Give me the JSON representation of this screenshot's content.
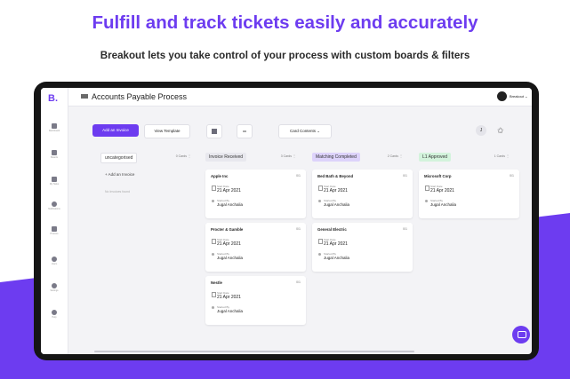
{
  "promo": {
    "title": "Fulfill and track tickets easily and accurately",
    "subtitle": "Breakout lets you take control of your process with custom boards & filters"
  },
  "app": {
    "logo": "B.",
    "title": "Accounts Payable Process",
    "user_name": "Breakout",
    "user_chevron": "⌄"
  },
  "sidebar": {
    "items": [
      {
        "label": "Dashboard",
        "icon": "dashboard-icon"
      },
      {
        "label": "Boards",
        "icon": "folder-icon"
      },
      {
        "label": "My Tasks",
        "icon": "tasks-icon"
      },
      {
        "label": "Notifications",
        "icon": "bell-icon"
      },
      {
        "label": "Process",
        "icon": "layers-icon"
      },
      {
        "label": "Users",
        "icon": "users-icon"
      },
      {
        "label": "Settings",
        "icon": "gear-icon"
      },
      {
        "label": "Help",
        "icon": "help-icon"
      }
    ]
  },
  "toolbar": {
    "add_label": "Add an Invoice",
    "view_label": "View Template",
    "card_contents_label": "Card Contents ⌄",
    "user_initial": "J",
    "star": "✩"
  },
  "columns": [
    {
      "title": "uncategorised",
      "count": "0 Cards",
      "menu": "⋮",
      "add_label": "+ Add an Invoice",
      "empty_label": "No Invoices found",
      "color": "#ffffff",
      "cards": []
    },
    {
      "title": "Invoice Received",
      "count": "3 Cards",
      "menu": "⋮",
      "color": "#e8e8ee",
      "cards": [
        {
          "title": "Apple Inc",
          "num": "0/1",
          "l1": "Start Date",
          "v1": "21 Apr 2021",
          "l2": "Started By",
          "v2": "Jugal Anchalia"
        },
        {
          "title": "Procter & Gamble",
          "num": "0/1",
          "l1": "Start Date",
          "v1": "21 Apr 2021",
          "l2": "Started By",
          "v2": "Jugal Anchalia"
        },
        {
          "title": "Nestle",
          "num": "0/1",
          "l1": "Start Date",
          "v1": "21 Apr 2021",
          "l2": "Started By",
          "v2": "Jugal Anchalia"
        }
      ]
    },
    {
      "title": "Matching Completed",
      "count": "2 Cards",
      "menu": "⋮",
      "color": "#ddd3fb",
      "cards": [
        {
          "title": "Bed Bath & Beyond",
          "num": "0/1",
          "l1": "Start Date",
          "v1": "21 Apr 2021",
          "l2": "Started By",
          "v2": "Jugal Anchalia"
        },
        {
          "title": "General Electric",
          "num": "0/1",
          "l1": "Start Date",
          "v1": "21 Apr 2021",
          "l2": "Started By",
          "v2": "Jugal Anchalia"
        }
      ]
    },
    {
      "title": "L1 Approved",
      "count": "1 Cards",
      "menu": "⋮",
      "color": "#d3f3dc",
      "cards": [
        {
          "title": "Microsoft Corp",
          "num": "0/1",
          "l1": "Start Date",
          "v1": "21 Apr 2021",
          "l2": "Started By",
          "v2": "Jugal Anchalia"
        }
      ]
    }
  ],
  "colors": {
    "accent": "#6d3cf0"
  }
}
